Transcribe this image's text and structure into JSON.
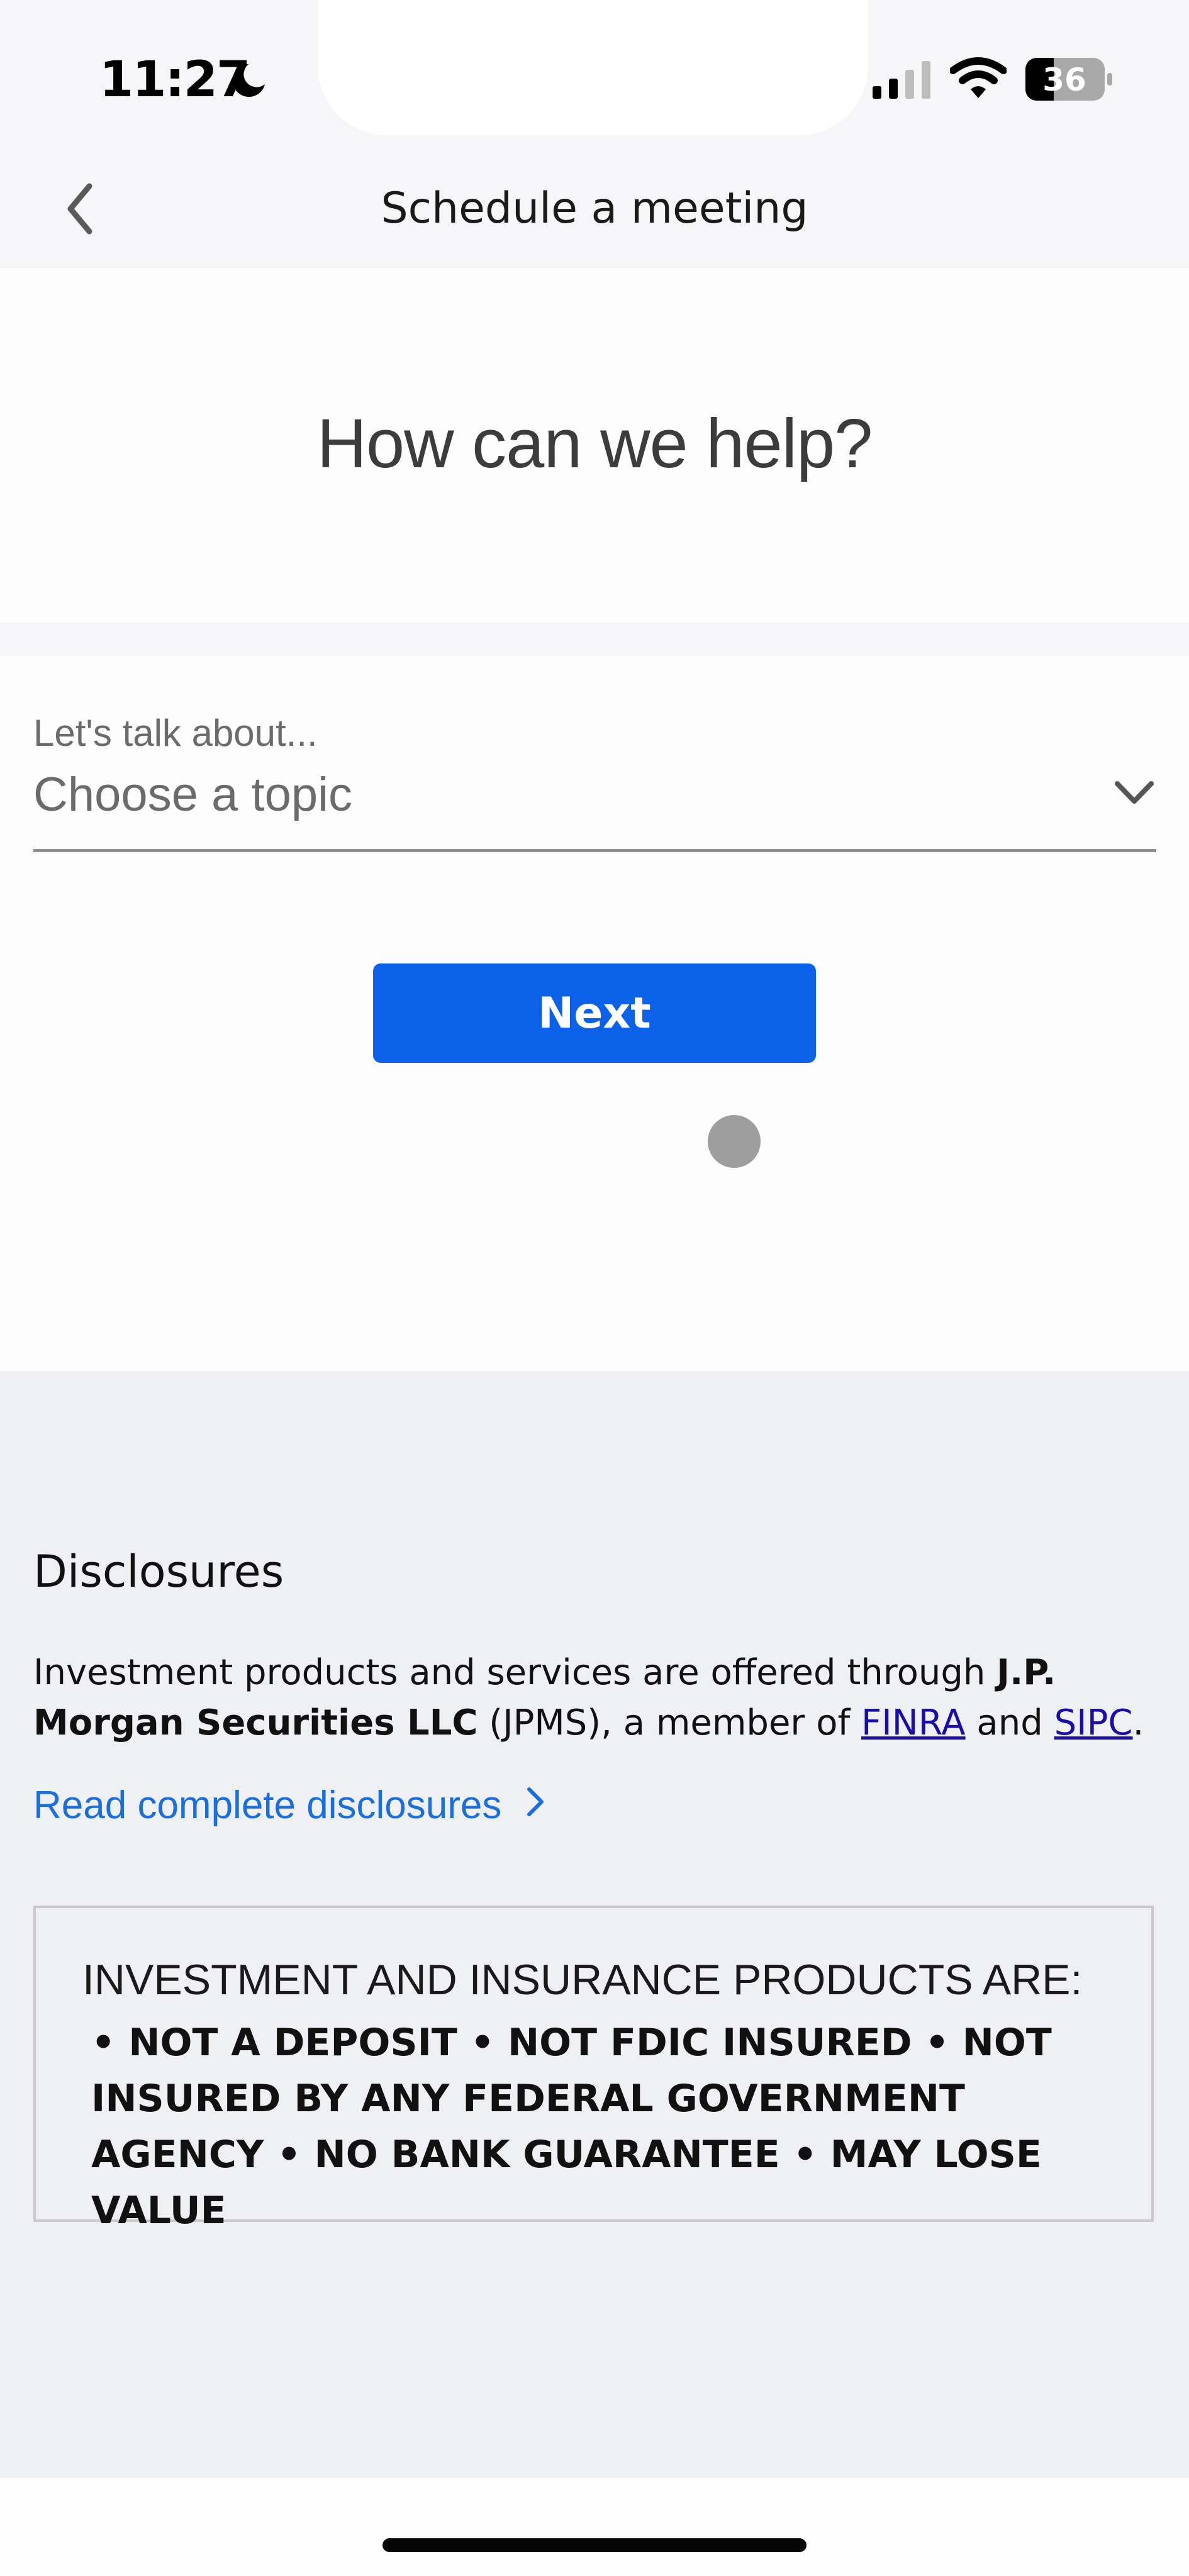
{
  "status_bar": {
    "time": "11:27",
    "focus_icon": "moon-icon",
    "signal_bars_active": 2,
    "signal_bars_total": 4,
    "wifi_icon": "wifi-icon",
    "battery_percent": "36"
  },
  "header": {
    "back_icon": "chevron-left-icon",
    "title": "Schedule a meeting"
  },
  "hero": {
    "title": "How can we help?"
  },
  "form": {
    "topic_label": "Let's talk about...",
    "topic_placeholder": "Choose a topic",
    "topic_icon": "chevron-down-icon",
    "next_label": "Next"
  },
  "disclosures": {
    "heading": "Disclosures",
    "body_prefix": "Investment products and services are offered through ",
    "body_bold": "J.P. Morgan Securities LLC",
    "body_mid": " (JPMS), a member of ",
    "link_finra": "FINRA",
    "body_and": " and ",
    "link_sipc": "SIPC",
    "body_end": ".",
    "read_more_label": "Read complete disclosures",
    "read_more_icon": "chevron-right-icon",
    "notice_heading": "INVESTMENT AND INSURANCE PRODUCTS ARE:",
    "notice_items": "• NOT A DEPOSIT • NOT FDIC INSURED • NOT INSURED BY ANY FEDERAL GOVERNMENT AGENCY • NO BANK GUARANTEE • MAY LOSE VALUE"
  },
  "colors": {
    "primary_button": "#0b62e8",
    "link_blue": "#1a6ee0",
    "inline_link": "#1a0dab",
    "disclosure_bg": "#eff0f4"
  }
}
